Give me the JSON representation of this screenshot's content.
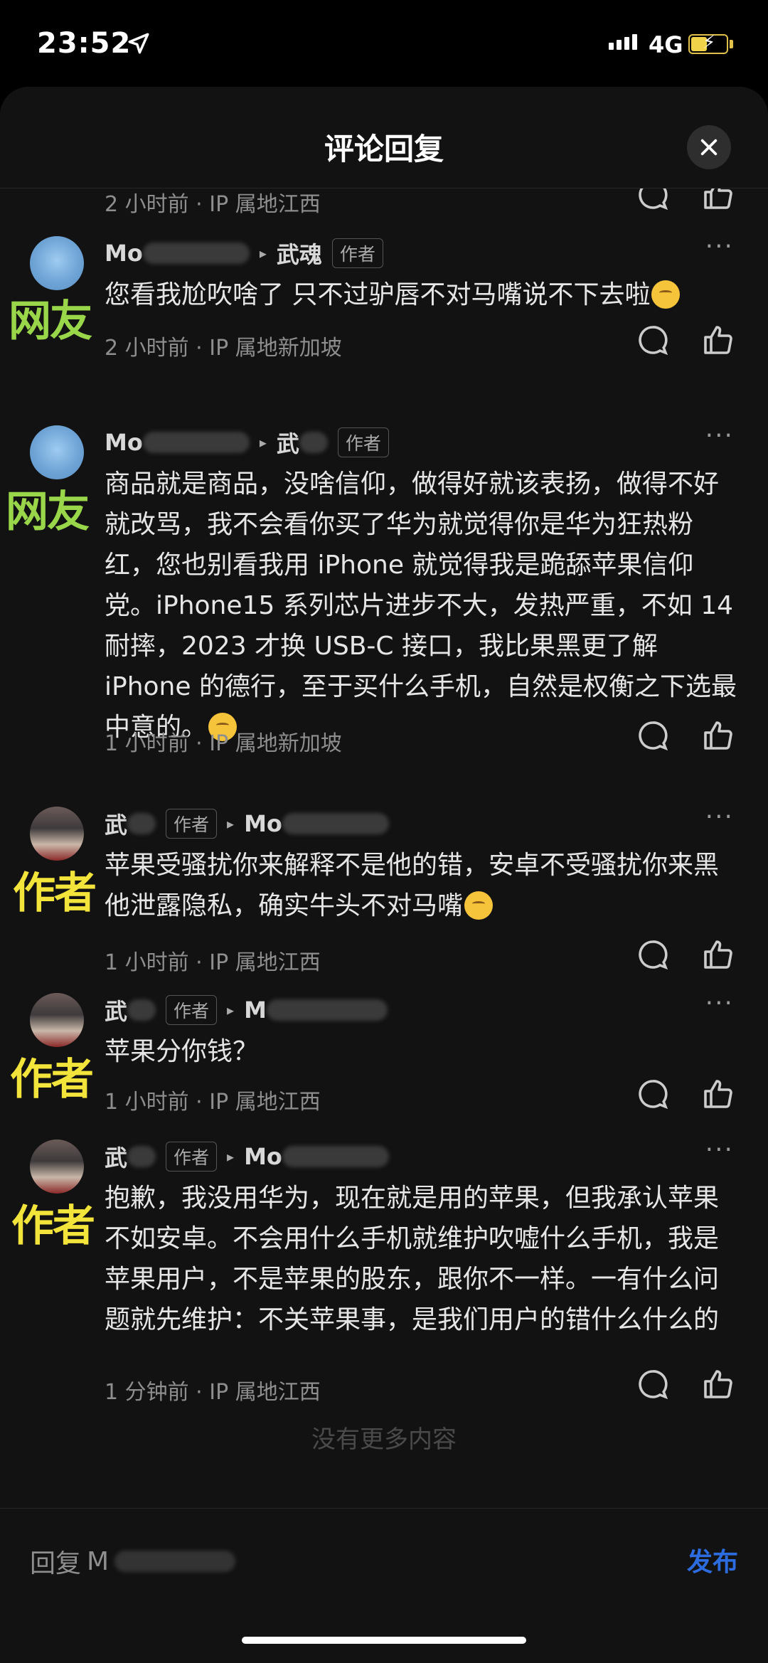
{
  "status_bar": {
    "time": "23:52",
    "network": "4G"
  },
  "header": {
    "title": "评论回复"
  },
  "partial_row": {
    "time": "2 小时前 · IP 属地江西"
  },
  "comments": [
    {
      "user": "Mo",
      "arrow": "▸",
      "reply_to": "武魂",
      "tag": "作者",
      "sticker": "网友",
      "text": "您看我尬吹啥了 只不过驴唇不对马嘴说不下去啦",
      "time": "2 小时前 · IP 属地新加坡"
    },
    {
      "user": "Mo",
      "arrow": "▸",
      "reply_to": "武",
      "tag": "作者",
      "sticker": "网友",
      "text": "商品就是商品，没啥信仰，做得好就该表扬，做得不好就改骂，我不会看你买了华为就觉得你是华为狂热粉红，您也别看我用 iPhone 就觉得我是跪舔苹果信仰党。iPhone15 系列芯片进步不大，发热严重，不如 14 耐摔，2023 才换 USB-C 接口，我比果黑更了解 iPhone 的德行，至于买什么手机，自然是权衡之下选最中意的。",
      "time": "1 小时前 · IP 属地新加坡"
    },
    {
      "user": "武",
      "tag": "作者",
      "arrow": "▸",
      "reply_to": "Mo",
      "sticker": "作者",
      "text": "苹果受骚扰你来解释不是他的错，安卓不受骚扰你来黑他泄露隐私，确实牛头不对马嘴",
      "time": "1 小时前 · IP 属地江西"
    },
    {
      "user": "武",
      "tag": "作者",
      "arrow": "▸",
      "reply_to": "M",
      "sticker": "作者",
      "text": "苹果分你钱？",
      "time": "1 小时前 · IP 属地江西"
    },
    {
      "user": "武",
      "tag": "作者",
      "arrow": "▸",
      "reply_to": "Mo",
      "sticker": "作者",
      "text": "抱歉，我没用华为，现在就是用的苹果，但我承认苹果不如安卓。不会用什么手机就维护吹嘘什么手机，我是苹果用户，不是苹果的股东，跟你不一样。一有什么问题就先维护：不关苹果事，是我们用户的错什么什么的",
      "time": "1 分钟前 · IP 属地江西"
    }
  ],
  "no_more": "没有更多内容",
  "bottom_bar": {
    "reply_prefix": "回复",
    "reply_user": "M",
    "publish": "发布"
  },
  "colors": {
    "sheet": "#121212",
    "publish": "#2d6cdf",
    "fan_sticker": "#9ad64a",
    "author_sticker": "#f2e43a"
  }
}
